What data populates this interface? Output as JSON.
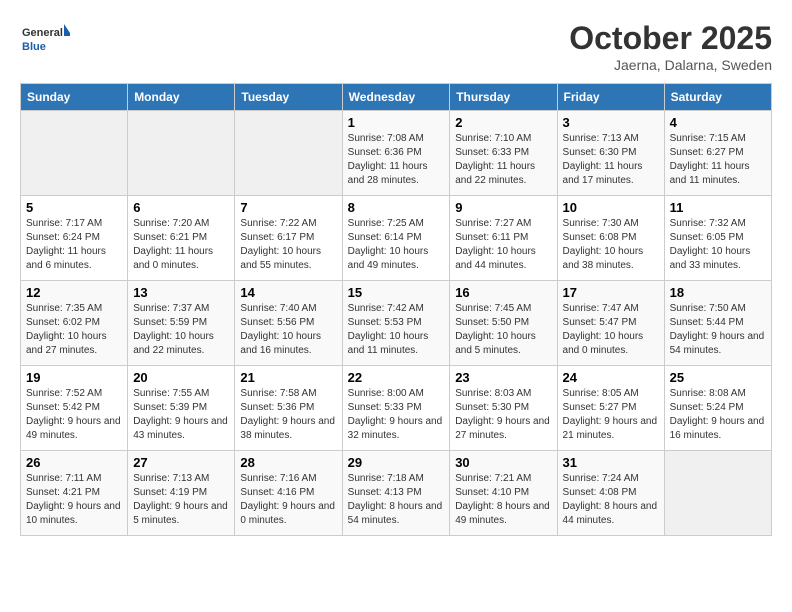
{
  "header": {
    "logo_general": "General",
    "logo_blue": "Blue",
    "month": "October 2025",
    "location": "Jaerna, Dalarna, Sweden"
  },
  "days_of_week": [
    "Sunday",
    "Monday",
    "Tuesday",
    "Wednesday",
    "Thursday",
    "Friday",
    "Saturday"
  ],
  "weeks": [
    [
      {
        "day": "",
        "info": ""
      },
      {
        "day": "",
        "info": ""
      },
      {
        "day": "",
        "info": ""
      },
      {
        "day": "1",
        "info": "Sunrise: 7:08 AM\nSunset: 6:36 PM\nDaylight: 11 hours and 28 minutes."
      },
      {
        "day": "2",
        "info": "Sunrise: 7:10 AM\nSunset: 6:33 PM\nDaylight: 11 hours and 22 minutes."
      },
      {
        "day": "3",
        "info": "Sunrise: 7:13 AM\nSunset: 6:30 PM\nDaylight: 11 hours and 17 minutes."
      },
      {
        "day": "4",
        "info": "Sunrise: 7:15 AM\nSunset: 6:27 PM\nDaylight: 11 hours and 11 minutes."
      }
    ],
    [
      {
        "day": "5",
        "info": "Sunrise: 7:17 AM\nSunset: 6:24 PM\nDaylight: 11 hours and 6 minutes."
      },
      {
        "day": "6",
        "info": "Sunrise: 7:20 AM\nSunset: 6:21 PM\nDaylight: 11 hours and 0 minutes."
      },
      {
        "day": "7",
        "info": "Sunrise: 7:22 AM\nSunset: 6:17 PM\nDaylight: 10 hours and 55 minutes."
      },
      {
        "day": "8",
        "info": "Sunrise: 7:25 AM\nSunset: 6:14 PM\nDaylight: 10 hours and 49 minutes."
      },
      {
        "day": "9",
        "info": "Sunrise: 7:27 AM\nSunset: 6:11 PM\nDaylight: 10 hours and 44 minutes."
      },
      {
        "day": "10",
        "info": "Sunrise: 7:30 AM\nSunset: 6:08 PM\nDaylight: 10 hours and 38 minutes."
      },
      {
        "day": "11",
        "info": "Sunrise: 7:32 AM\nSunset: 6:05 PM\nDaylight: 10 hours and 33 minutes."
      }
    ],
    [
      {
        "day": "12",
        "info": "Sunrise: 7:35 AM\nSunset: 6:02 PM\nDaylight: 10 hours and 27 minutes."
      },
      {
        "day": "13",
        "info": "Sunrise: 7:37 AM\nSunset: 5:59 PM\nDaylight: 10 hours and 22 minutes."
      },
      {
        "day": "14",
        "info": "Sunrise: 7:40 AM\nSunset: 5:56 PM\nDaylight: 10 hours and 16 minutes."
      },
      {
        "day": "15",
        "info": "Sunrise: 7:42 AM\nSunset: 5:53 PM\nDaylight: 10 hours and 11 minutes."
      },
      {
        "day": "16",
        "info": "Sunrise: 7:45 AM\nSunset: 5:50 PM\nDaylight: 10 hours and 5 minutes."
      },
      {
        "day": "17",
        "info": "Sunrise: 7:47 AM\nSunset: 5:47 PM\nDaylight: 10 hours and 0 minutes."
      },
      {
        "day": "18",
        "info": "Sunrise: 7:50 AM\nSunset: 5:44 PM\nDaylight: 9 hours and 54 minutes."
      }
    ],
    [
      {
        "day": "19",
        "info": "Sunrise: 7:52 AM\nSunset: 5:42 PM\nDaylight: 9 hours and 49 minutes."
      },
      {
        "day": "20",
        "info": "Sunrise: 7:55 AM\nSunset: 5:39 PM\nDaylight: 9 hours and 43 minutes."
      },
      {
        "day": "21",
        "info": "Sunrise: 7:58 AM\nSunset: 5:36 PM\nDaylight: 9 hours and 38 minutes."
      },
      {
        "day": "22",
        "info": "Sunrise: 8:00 AM\nSunset: 5:33 PM\nDaylight: 9 hours and 32 minutes."
      },
      {
        "day": "23",
        "info": "Sunrise: 8:03 AM\nSunset: 5:30 PM\nDaylight: 9 hours and 27 minutes."
      },
      {
        "day": "24",
        "info": "Sunrise: 8:05 AM\nSunset: 5:27 PM\nDaylight: 9 hours and 21 minutes."
      },
      {
        "day": "25",
        "info": "Sunrise: 8:08 AM\nSunset: 5:24 PM\nDaylight: 9 hours and 16 minutes."
      }
    ],
    [
      {
        "day": "26",
        "info": "Sunrise: 7:11 AM\nSunset: 4:21 PM\nDaylight: 9 hours and 10 minutes."
      },
      {
        "day": "27",
        "info": "Sunrise: 7:13 AM\nSunset: 4:19 PM\nDaylight: 9 hours and 5 minutes."
      },
      {
        "day": "28",
        "info": "Sunrise: 7:16 AM\nSunset: 4:16 PM\nDaylight: 9 hours and 0 minutes."
      },
      {
        "day": "29",
        "info": "Sunrise: 7:18 AM\nSunset: 4:13 PM\nDaylight: 8 hours and 54 minutes."
      },
      {
        "day": "30",
        "info": "Sunrise: 7:21 AM\nSunset: 4:10 PM\nDaylight: 8 hours and 49 minutes."
      },
      {
        "day": "31",
        "info": "Sunrise: 7:24 AM\nSunset: 4:08 PM\nDaylight: 8 hours and 44 minutes."
      },
      {
        "day": "",
        "info": ""
      }
    ]
  ]
}
